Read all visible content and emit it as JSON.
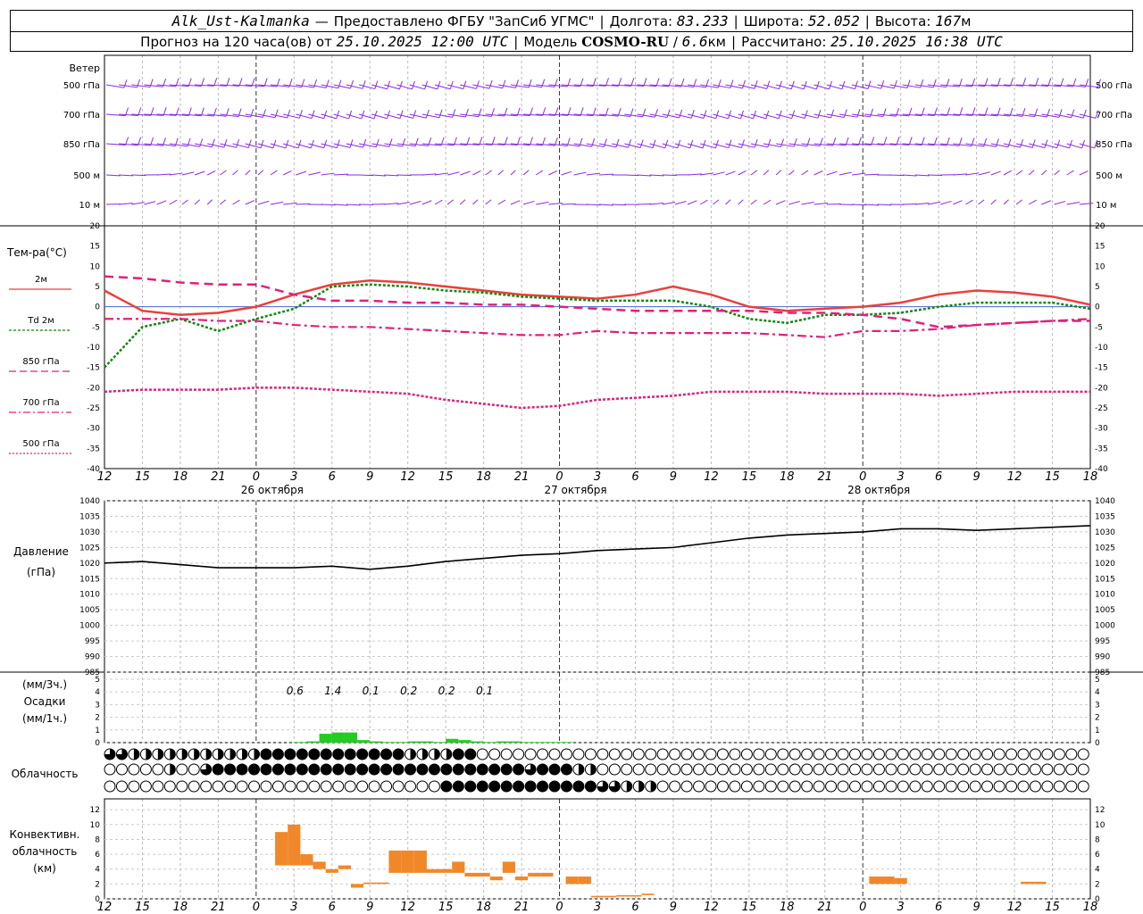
{
  "header": {
    "station": "Alk_Ust-Kalmanka",
    "provider": "Предоставлено ФГБУ \"ЗапСиб УГМС\"",
    "lon_label": "Долгота:",
    "lon": "83.233",
    "lat_label": "Широта:",
    "lat": "52.052",
    "alt_label": "Высота:",
    "alt": "167",
    "alt_unit": "м",
    "forecast_prefix": "Прогноз на 120 часа(ов) от",
    "forecast_time": "25.10.2025 12:00 UTC",
    "model_label": "Модель",
    "model": "COSMO-RU",
    "model_res": "6.6",
    "model_res_unit": "км",
    "calc_label": "Рассчитано:",
    "calc_time": "25.10.2025 16:38 UTC"
  },
  "colors": {
    "t2m": "#e8403c",
    "td": "#118811",
    "p850": "#e0207a",
    "p700": "#e0207a",
    "p500": "#e0207a",
    "wind": "#8a2be2",
    "precip": "#22cc22",
    "conv": "#f0882a",
    "pressure": "#000000"
  },
  "wind_panel": {
    "title": "Ветер",
    "levels": [
      "500 гПа",
      "700 гПа",
      "850 гПа",
      "500 м",
      "10 м"
    ]
  },
  "temp_panel": {
    "title": "Тем-ра(°C)",
    "legend": [
      "2м",
      "Td",
      "2м",
      "850 гПа",
      "700 гПа",
      "500 гПа"
    ],
    "yticks": [
      "20",
      "15",
      "10",
      "5",
      "0",
      "-5",
      "-10",
      "-15",
      "-20",
      "-25",
      "-30",
      "-35",
      "-40"
    ]
  },
  "pressure_panel": {
    "title": "Давление",
    "unit": "(гПа)",
    "yticks": [
      "1040",
      "1035",
      "1030",
      "1025",
      "1020",
      "1015",
      "1010",
      "1005",
      "1000",
      "995",
      "990",
      "985"
    ]
  },
  "precip_panel": {
    "label_a": "(мм/3ч.)",
    "label_b": "Осадки",
    "label_c": "(мм/1ч.)",
    "yticks": [
      "5",
      "4",
      "3",
      "2",
      "1",
      "0"
    ],
    "amounts": [
      "0.6",
      "1.4",
      "0.1",
      "0.2",
      "0.2",
      "0.1"
    ]
  },
  "cloud_panel": {
    "title": "Облачность"
  },
  "conv_panel": {
    "label_a": "Конвективн.",
    "label_b": "облачность",
    "label_c": "(км)",
    "yticks": [
      "12",
      "10",
      "8",
      "6",
      "4",
      "2",
      "0"
    ]
  },
  "x_axis": {
    "hour_labels": [
      "12",
      "15",
      "18",
      "21",
      "0",
      "3",
      "6",
      "9",
      "12",
      "15",
      "18",
      "21",
      "0",
      "3",
      "6",
      "9",
      "12",
      "15",
      "18",
      "21",
      "0",
      "3",
      "6",
      "9",
      "12",
      "15",
      "18"
    ],
    "dates": [
      "26 октября",
      "27 октября",
      "28 октября"
    ]
  },
  "chart_data": [
    {
      "type": "line",
      "title": "Тем-ра(°C)",
      "x_hours": [
        0,
        3,
        6,
        9,
        12,
        15,
        18,
        21,
        24,
        27,
        30,
        33,
        36,
        39,
        42,
        45,
        48,
        51,
        54,
        57,
        60,
        63,
        66,
        69,
        72,
        75,
        78
      ],
      "ylim": [
        -40,
        20
      ],
      "series": [
        {
          "name": "2м",
          "values": [
            4,
            -1,
            -2,
            -1.5,
            0,
            3,
            5.5,
            6.5,
            6,
            5,
            4,
            3,
            2.5,
            2,
            3,
            5,
            3,
            0,
            -1,
            -0.5,
            0,
            1,
            3,
            4,
            3.5,
            2.5,
            0.5
          ]
        },
        {
          "name": "Td 2м",
          "values": [
            -15,
            -5,
            -3,
            -6,
            -3,
            -0.5,
            5,
            5.5,
            5,
            4,
            3.5,
            2.5,
            2,
            1.5,
            1.5,
            1.5,
            0,
            -3,
            -4,
            -2,
            -2,
            -1.5,
            0,
            1,
            1,
            1,
            -0.5
          ]
        },
        {
          "name": "850 гПа",
          "values": [
            7.5,
            7,
            6,
            5.5,
            5.5,
            3,
            1.5,
            1.5,
            1,
            1,
            0.5,
            0.5,
            0,
            -0.5,
            -1,
            -1,
            -1,
            -1,
            -1.5,
            -1.5,
            -2,
            -3,
            -5,
            -4.5,
            -4,
            -3.5,
            -3.5
          ]
        },
        {
          "name": "700 гПа",
          "values": [
            -3,
            -3,
            -3,
            -3.5,
            -3.5,
            -4.5,
            -5,
            -5,
            -5.5,
            -6,
            -6.5,
            -7,
            -7,
            -6,
            -6.5,
            -6.5,
            -6.5,
            -6.5,
            -7,
            -7.5,
            -6,
            -6,
            -5.5,
            -4.5,
            -4,
            -3.5,
            -3
          ]
        },
        {
          "name": "500 гПа",
          "values": [
            -21,
            -20.5,
            -20.5,
            -20.5,
            -20,
            -20,
            -20.5,
            -21,
            -21.5,
            -23,
            -24,
            -25,
            -24.5,
            -23,
            -22.5,
            -22,
            -21,
            -21,
            -21,
            -21.5,
            -21.5,
            -21.5,
            -22,
            -21.5,
            -21,
            -21,
            -21
          ]
        }
      ]
    },
    {
      "type": "line",
      "title": "Давление",
      "x_hours": [
        0,
        3,
        6,
        9,
        12,
        15,
        18,
        21,
        24,
        27,
        30,
        33,
        36,
        39,
        42,
        45,
        48,
        51,
        54,
        57,
        60,
        63,
        66,
        69,
        72,
        75,
        78
      ],
      "ylim": [
        985,
        1040
      ],
      "series": [
        {
          "name": "Давление",
          "values": [
            1020,
            1020.5,
            1019.5,
            1018.5,
            1018.5,
            1018.5,
            1019,
            1018,
            1019,
            1020.5,
            1021.5,
            1022.5,
            1023,
            1024,
            1024.5,
            1025,
            1026.5,
            1028,
            1029,
            1029.5,
            1030,
            1031,
            1031,
            1030.5,
            1031,
            1031.5,
            1032
          ]
        }
      ]
    },
    {
      "type": "bar",
      "title": "Осадки",
      "x_hours": [
        15,
        16,
        17,
        18,
        19,
        20,
        21,
        22,
        23,
        24,
        25,
        26,
        27,
        28,
        29,
        30,
        31,
        32,
        33,
        34,
        35,
        36
      ],
      "ylim": [
        0,
        5
      ],
      "values": [
        0.05,
        0.1,
        0.7,
        0.8,
        0.8,
        0.2,
        0.1,
        0.05,
        0.05,
        0.1,
        0.1,
        0.05,
        0.3,
        0.2,
        0.1,
        0.05,
        0.1,
        0.1,
        0.05,
        0.05,
        0.05,
        0.05
      ]
    },
    {
      "type": "bar",
      "title": "Конвективн. облачность (км)",
      "ylim": [
        0,
        13
      ],
      "bars": [
        {
          "x": 14,
          "base": 4.5,
          "top": 9
        },
        {
          "x": 15,
          "base": 4.5,
          "top": 10
        },
        {
          "x": 16,
          "base": 4.5,
          "top": 6
        },
        {
          "x": 17,
          "base": 4,
          "top": 5
        },
        {
          "x": 18,
          "base": 3.5,
          "top": 4
        },
        {
          "x": 19,
          "base": 4,
          "top": 4.5
        },
        {
          "x": 20,
          "base": 1.5,
          "top": 2
        },
        {
          "x": 21,
          "base": 2,
          "top": 2.2
        },
        {
          "x": 22,
          "base": 2,
          "top": 2.2
        },
        {
          "x": 23,
          "base": 3.5,
          "top": 6.5
        },
        {
          "x": 24,
          "base": 3.5,
          "top": 6.5
        },
        {
          "x": 25,
          "base": 3.5,
          "top": 6.5
        },
        {
          "x": 26,
          "base": 3.5,
          "top": 4
        },
        {
          "x": 27,
          "base": 3.5,
          "top": 4
        },
        {
          "x": 28,
          "base": 3.5,
          "top": 5
        },
        {
          "x": 29,
          "base": 3,
          "top": 3.5
        },
        {
          "x": 30,
          "base": 3,
          "top": 3.5
        },
        {
          "x": 31,
          "base": 2.5,
          "top": 3
        },
        {
          "x": 32,
          "base": 3.5,
          "top": 5
        },
        {
          "x": 33,
          "base": 2.5,
          "top": 3
        },
        {
          "x": 34,
          "base": 3,
          "top": 3.5
        },
        {
          "x": 35,
          "base": 3,
          "top": 3.5
        },
        {
          "x": 37,
          "base": 2,
          "top": 3
        },
        {
          "x": 38,
          "base": 2,
          "top": 3
        },
        {
          "x": 39,
          "base": 0.2,
          "top": 0.4
        },
        {
          "x": 40,
          "base": 0.2,
          "top": 0.4
        },
        {
          "x": 41,
          "base": 0.3,
          "top": 0.5
        },
        {
          "x": 42,
          "base": 0.3,
          "top": 0.5
        },
        {
          "x": 43,
          "base": 0.5,
          "top": 0.7
        },
        {
          "x": 61,
          "base": 2,
          "top": 3
        },
        {
          "x": 62,
          "base": 2,
          "top": 3
        },
        {
          "x": 63,
          "base": 2,
          "top": 2.8
        },
        {
          "x": 73,
          "base": 2,
          "top": 2.3
        },
        {
          "x": 74,
          "base": 2,
          "top": 2.3
        }
      ]
    },
    {
      "type": "table",
      "title": "Облачность",
      "rows": [
        "qqhhhhhhhhhhhffffffffffffhhhhffeeeeeeeeeeeeeeeeeeeeeeeeeeeeeeeeeeeeeeeeeeeeeeeeeee",
        "eeeeeheeqffffffffffffffffffffffffffqfffhheeeeeeeeeeeeeeeeeeeeeeeeeeeeeeeeeeeeeeeee",
        "eeeeeeeeeeeeeeeeeeeeeeeeeeeefffffffffffffqqhhheeeeeeeeeeeeeeeeeeeeeeeeeeeeeeeeeeeeee"
      ]
    }
  ]
}
